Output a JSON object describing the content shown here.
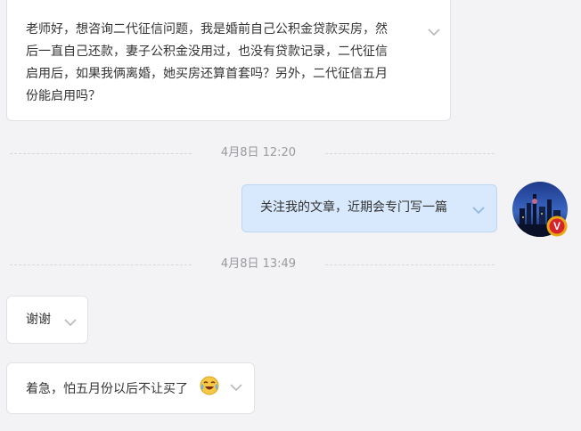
{
  "messages": [
    {
      "direction": "incoming",
      "text": "老师好，想咨询二代征信问题，我是婚前自己公积金贷款买房，然\n后一直自己还款，妻子公积金没用过，也没有贷款记录，二代征信\n启用后，如果我俩离婚，她买房还算首套吗？另外，二代征信五月\n份能启用吗？"
    },
    {
      "direction": "outgoing",
      "text": "关注我的文章，近期会专门写一篇"
    },
    {
      "direction": "incoming",
      "text": "谢谢"
    },
    {
      "direction": "incoming",
      "text": "着急，怕五月份以后不让买了",
      "emoji": "crying-laughing-emoji"
    }
  ],
  "timestamps": [
    "4月8日 12:20",
    "4月8日 13:49"
  ],
  "avatar": {
    "badge_letter": "V",
    "badge_color": "#e8a714",
    "badge_inner_color": "#d9232a"
  },
  "colors": {
    "background": "#f3f3f5",
    "incoming_bubble": "#ffffff",
    "outgoing_bubble": "#d8e9fd",
    "timestamp_text": "#9a9a9e"
  }
}
